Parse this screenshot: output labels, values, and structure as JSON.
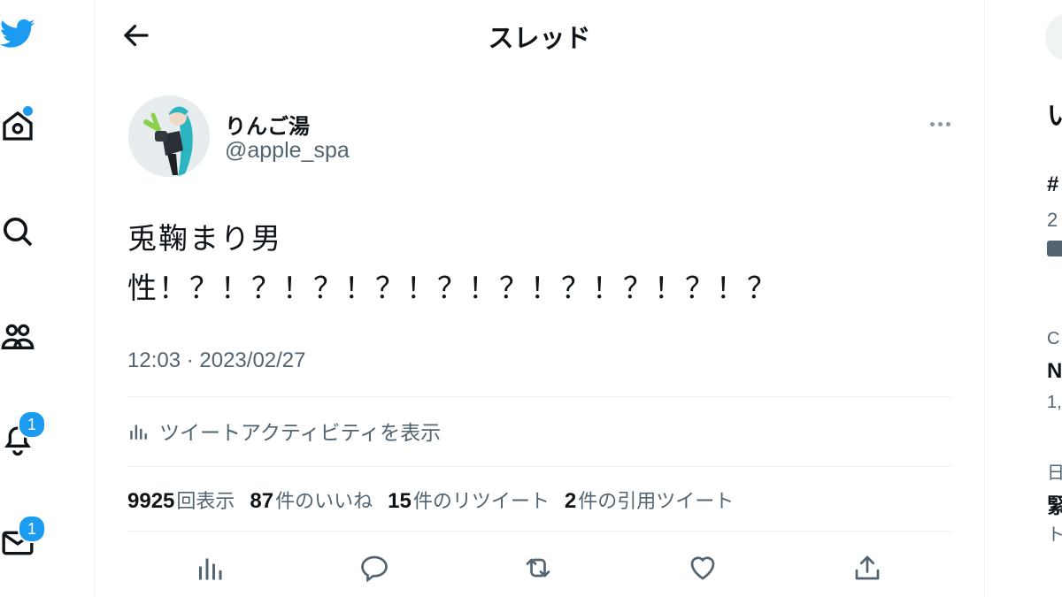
{
  "header": {
    "title": "スレッド"
  },
  "nav": {
    "notifications_badge": "1",
    "messages_badge": "1"
  },
  "tweet": {
    "display_name": "りんご湯",
    "handle": "@apple_spa",
    "text": "兎鞠まり男\n性！？！？！？！？！？！？！？！？！？！？",
    "timestamp": "12:03 · 2023/02/27",
    "activity_label": "ツイートアクティビティを表示",
    "stats": [
      {
        "num": "9925",
        "label": "回表示"
      },
      {
        "num": "87",
        "label": "件のいいね"
      },
      {
        "num": "15",
        "label": "件のリツイート"
      },
      {
        "num": "2",
        "label": "件の引用ツイート"
      }
    ]
  },
  "right_column": {
    "heading": "い",
    "trend1_tag": "#",
    "trend1_count": "2",
    "trend2_cat": "C",
    "trend2_name": "N",
    "trend2_count": "1,",
    "trend3_cat": "日",
    "trend3_name": "緊",
    "trend3_sub": "ト"
  },
  "colors": {
    "accent": "#1d9bf0",
    "text": "#0f1419",
    "muted": "#536471",
    "divider": "#eff3f4"
  },
  "icons": [
    "twitter-bird-icon",
    "home-icon",
    "search-icon",
    "communities-icon",
    "bell-icon",
    "mail-icon",
    "back-arrow-icon",
    "more-icon",
    "analytics-icon",
    "reply-icon",
    "retweet-icon",
    "like-icon",
    "share-icon"
  ]
}
